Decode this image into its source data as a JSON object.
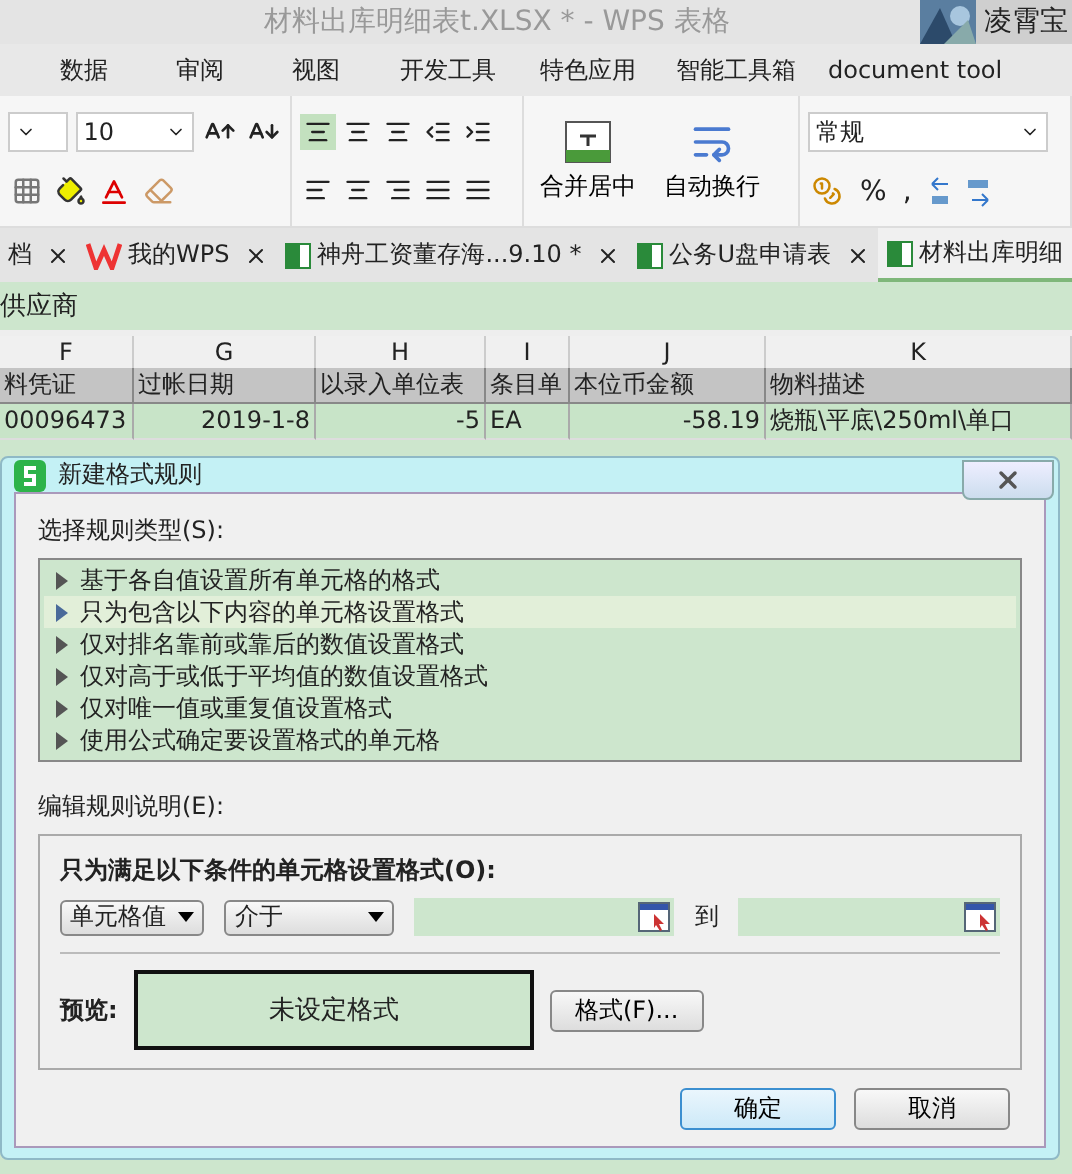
{
  "window": {
    "title": "材料出库明细表t.XLSX * - WPS 表格",
    "user": "凌霄宝"
  },
  "menu": [
    {
      "label": "数据"
    },
    {
      "label": "审阅"
    },
    {
      "label": "视图"
    },
    {
      "label": "开发工具"
    },
    {
      "label": "特色应用"
    },
    {
      "label": "智能工具箱"
    },
    {
      "label": "document tool"
    }
  ],
  "ribbon": {
    "font_size": "10",
    "number_format": "常规",
    "merge_label": "合并居中",
    "wrap_label": "自动换行",
    "percent": "%",
    "comma": ","
  },
  "doc_tabs": [
    {
      "label": "档",
      "kind": "plain",
      "selected": false
    },
    {
      "label": "我的WPS",
      "kind": "wps",
      "selected": false
    },
    {
      "label": "神舟工资董存海...9.10 *",
      "kind": "sheet",
      "selected": false
    },
    {
      "label": "公务U盘申请表",
      "kind": "sheet",
      "selected": false
    },
    {
      "label": "材料出库明细",
      "kind": "sheet",
      "selected": true
    }
  ],
  "name_row": "供应商",
  "sheet": {
    "columns": [
      "F",
      "G",
      "H",
      "I",
      "J",
      "K"
    ],
    "header": [
      "料凭证",
      "过帐日期",
      "以录入单位表",
      "条目单",
      "本位币金额",
      "物料描述"
    ],
    "rows": [
      [
        "00096473",
        "2019-1-8",
        "-5",
        "EA",
        "-58.19",
        "烧瓶\\平底\\250ml\\单口"
      ]
    ]
  },
  "dialog": {
    "title": "新建格式规则",
    "type_label": "选择规则类型(S):",
    "rule_types": [
      {
        "label": "基于各自值设置所有单元格的格式",
        "selected": false
      },
      {
        "label": "只为包含以下内容的单元格设置格式",
        "selected": true
      },
      {
        "label": "仅对排名靠前或靠后的数值设置格式",
        "selected": false
      },
      {
        "label": "仅对高于或低于平均值的数值设置格式",
        "selected": false
      },
      {
        "label": "仅对唯一值或重复值设置格式",
        "selected": false
      },
      {
        "label": "使用公式确定要设置格式的单元格",
        "selected": false
      }
    ],
    "edit_label": "编辑规则说明(E):",
    "condition_label": "只为满足以下条件的单元格设置格式(O):",
    "operand": "单元格值",
    "operator": "介于",
    "to_label": "到",
    "preview_label": "预览:",
    "preview_text": "未设定格式",
    "format_button": "格式(F)...",
    "buttons": [
      {
        "label": "确定",
        "default": true
      },
      {
        "label": "取消",
        "default": false
      }
    ]
  }
}
